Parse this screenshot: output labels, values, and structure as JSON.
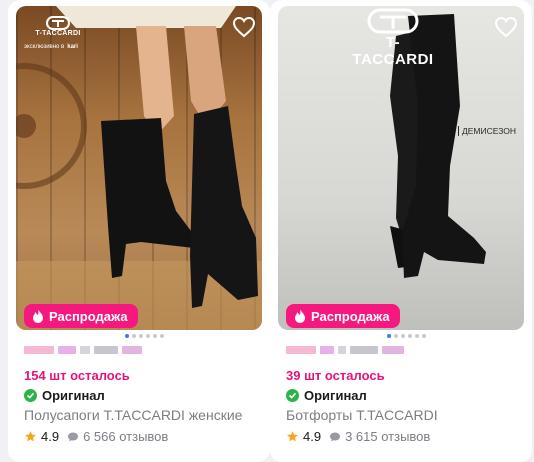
{
  "products": [
    {
      "brand_logo_text": "T-TACCARDI",
      "brand_exclusive": "эксклюзивно в",
      "brand_partner": "kari",
      "sale_badge": "Распродажа",
      "left_count": "154 шт осталось",
      "original_label": "Оригинал",
      "title": "Полусапоги T.TACCARDI женские",
      "rating": "4.9",
      "reviews": "6 566 отзывов",
      "photo_dots": 6,
      "active_dot": 1
    },
    {
      "brand_logo_text": "T-TACCARDI",
      "season_label": "ДЕМИСЕЗОН",
      "sale_badge": "Распродажа",
      "left_count": "39 шт осталось",
      "original_label": "Оригинал",
      "title": "Ботфорты T.TACCARDI",
      "rating": "4.9",
      "reviews": "3 615 отзывов",
      "photo_dots": 6,
      "active_dot": 1
    }
  ],
  "colors": {
    "accent": "#f5187e",
    "left_text": "#e8137a",
    "original_check": "#2bb34a",
    "star": "#f5a623",
    "active_dot": "#3d7bf5"
  },
  "icons": [
    "heart-icon",
    "fire-icon",
    "check-circle-icon",
    "star-icon",
    "chat-bubble-icon"
  ]
}
